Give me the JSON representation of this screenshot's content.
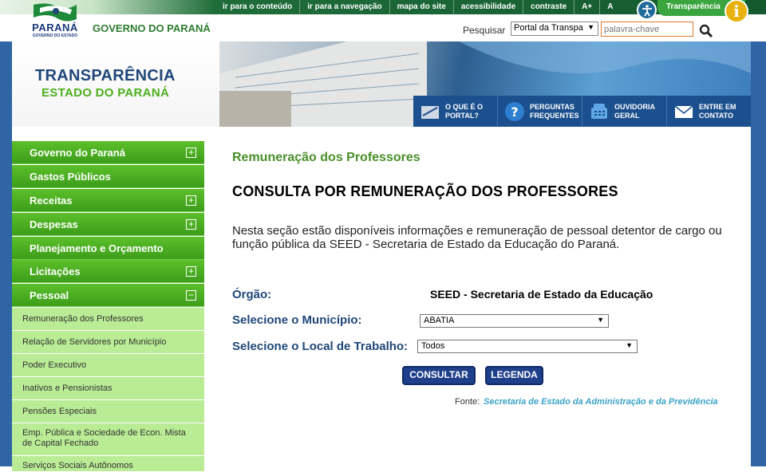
{
  "header": {
    "logo_title": "PARANÁ",
    "logo_subtitle": "GOVERNO DO ESTADO",
    "government_name": "GOVERNO DO PARANÁ",
    "top_links": [
      {
        "label": "ir para o conteúdo"
      },
      {
        "label": "ir para a navegação"
      },
      {
        "label": "mapa do site"
      },
      {
        "label": "acessibilidade"
      },
      {
        "label": "contraste"
      },
      {
        "label": "A+"
      },
      {
        "label": "A"
      }
    ],
    "transparencia_label": "Transparência",
    "search_label": "Pesquisar",
    "search_scope": "Portal da Transpa",
    "search_placeholder": "palavra-chave"
  },
  "banner": {
    "title": "TRANSPARÊNCIA",
    "subtitle": "ESTADO DO PARANÁ",
    "links": [
      {
        "label": "O QUE É O PORTAL?",
        "icon": "portal-icon"
      },
      {
        "label": "PERGUNTAS FREQUENTES",
        "icon": "question-icon"
      },
      {
        "label": "OUVIDORIA GERAL",
        "icon": "phone-icon"
      },
      {
        "label": "ENTRE EM CONTATO",
        "icon": "mail-icon"
      }
    ]
  },
  "sidebar": {
    "main_items": [
      {
        "label": "Governo do Paraná",
        "toggle": "+"
      },
      {
        "label": "Gastos Públicos",
        "toggle": ""
      },
      {
        "label": "Receitas",
        "toggle": "+"
      },
      {
        "label": "Despesas",
        "toggle": "+"
      },
      {
        "label": "Planejamento e Orçamento",
        "toggle": ""
      },
      {
        "label": "Licitações",
        "toggle": "+"
      },
      {
        "label": "Pessoal",
        "toggle": "−"
      }
    ],
    "sub_items": [
      {
        "label": "Remuneração dos Professores"
      },
      {
        "label": "Relação de Servidores por Município"
      },
      {
        "label": "Poder Executivo"
      },
      {
        "label": "Inativos e Pensionistas"
      },
      {
        "label": "Pensões Especiais"
      },
      {
        "label": "Emp. Pública e Sociedade de Econ. Mista de Capital Fechado"
      },
      {
        "label": "Serviços Sociais Autônomos"
      }
    ]
  },
  "main": {
    "section_title": "Remuneração dos Professores",
    "heading": "CONSULTA POR REMUNERAÇÃO DOS PROFESSORES",
    "intro": "Nesta seção estão disponíveis informações e remuneração de pessoal detentor de cargo ou função pública da SEED - Secretaria de Estado da Educação do Paraná.",
    "orgao_label": "Órgão:",
    "orgao_value": "SEED - Secretaria de Estado da Educação",
    "municipio_label": "Selecione o Município:",
    "municipio_value": "ABATIA",
    "local_label": "Selecione o Local de Trabalho:",
    "local_value": "Todos",
    "consultar_label": "CONSULTAR",
    "legenda_label": "LEGENDA",
    "fonte_label": "Fonte:",
    "fonte_link": "Secretaria de Estado da Administração e da Previdência"
  },
  "colors": {
    "brand_blue": "#1f4778",
    "menu_green": "#4caf1e",
    "submenu_green": "#b9ec95",
    "button_blue": "#1e3f8a",
    "link_cyan": "#3aa3c8"
  }
}
